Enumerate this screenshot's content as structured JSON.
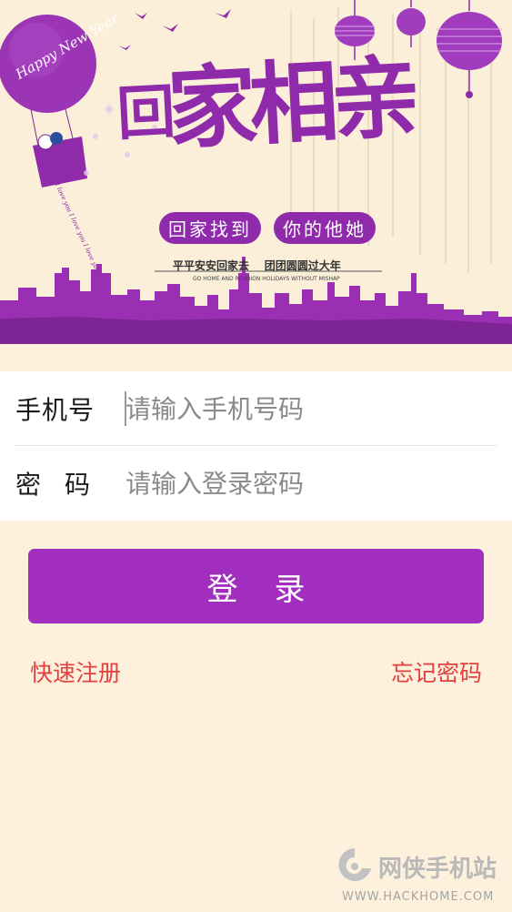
{
  "banner": {
    "title": "回家相亲",
    "title_first": "回",
    "title_rest": "家相亲",
    "slogan_left": "回家找到",
    "slogan_right": "你的他她",
    "sub_slogan": "平平安安回家去    团团圆圆过大年",
    "sub_slogan_en": "GO HOME AND REUNION HOLIDAYS WITHOUT MISHAP",
    "balloon_text": "Happy New Year",
    "ribbon_text": "I love you I love you I love you",
    "colors": {
      "accent": "#8f2bab",
      "background": "#fbefd9",
      "balloon": "#9b34b5"
    }
  },
  "form": {
    "phone_label": "手机号",
    "phone_placeholder": "请输入手机号码",
    "phone_value": "",
    "password_label": "密码",
    "password_placeholder": "请输入登录密码",
    "password_value": ""
  },
  "actions": {
    "login_label": "登录",
    "register_label": "快速注册",
    "forgot_label": "忘记密码"
  },
  "watermark": {
    "cn": "网侠手机站",
    "en": "WWW.HACKHOME.COM"
  },
  "colors": {
    "page_bg": "#fdf0dc",
    "button": "#a12ebc",
    "link": "#e2413f"
  }
}
